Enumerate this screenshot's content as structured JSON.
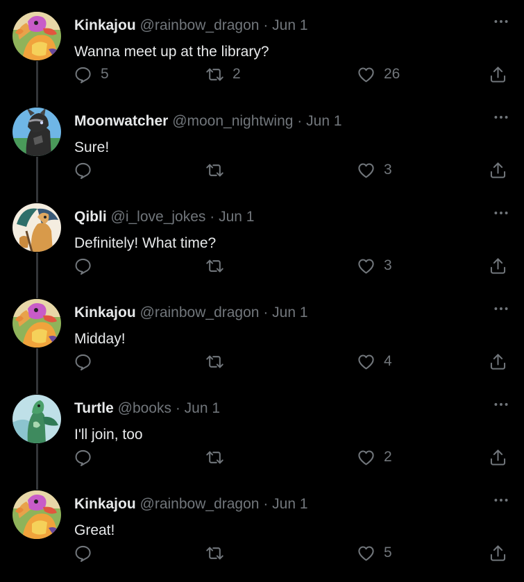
{
  "colors": {
    "background": "#000000",
    "text_primary": "#e7e9ea",
    "text_secondary": "#71767b",
    "thread_line": "#333639"
  },
  "icons": {
    "reply": "speech-bubble-icon",
    "retweet": "retweet-arrows-icon",
    "like": "heart-icon",
    "share": "share-upload-icon",
    "more": "three-dots-icon"
  },
  "tweets": [
    {
      "name": "Kinkajou",
      "handle": "@rainbow_dragon",
      "separator": "·",
      "date": "Jun 1",
      "text": "Wanna meet up at the library?",
      "avatar": "kinkajou-avatar",
      "replies": "5",
      "retweets": "2",
      "likes": "26"
    },
    {
      "name": "Moonwatcher",
      "handle": "@moon_nightwing",
      "separator": "·",
      "date": "Jun 1",
      "text": "Sure!",
      "avatar": "moonwatcher-avatar",
      "replies": "",
      "retweets": "",
      "likes": "3"
    },
    {
      "name": "Qibli",
      "handle": "@i_love_jokes",
      "separator": "·",
      "date": "Jun 1",
      "text": "Definitely! What time?",
      "avatar": "qibli-avatar",
      "replies": "",
      "retweets": "",
      "likes": "3"
    },
    {
      "name": "Kinkajou",
      "handle": "@rainbow_dragon",
      "separator": "·",
      "date": "Jun 1",
      "text": "Midday!",
      "avatar": "kinkajou-avatar",
      "replies": "",
      "retweets": "",
      "likes": "4"
    },
    {
      "name": "Turtle",
      "handle": "@books",
      "separator": "·",
      "date": "Jun 1",
      "text": "I'll join, too",
      "avatar": "turtle-avatar",
      "replies": "",
      "retweets": "",
      "likes": "2"
    },
    {
      "name": "Kinkajou",
      "handle": "@rainbow_dragon",
      "separator": "·",
      "date": "Jun 1",
      "text": "Great!",
      "avatar": "kinkajou-avatar",
      "replies": "",
      "retweets": "",
      "likes": "5"
    }
  ]
}
